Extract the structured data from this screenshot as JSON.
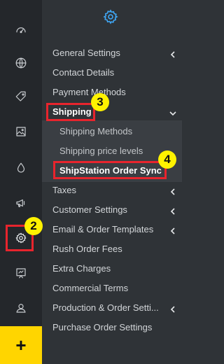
{
  "colors": {
    "rail": "#24272b",
    "panel": "#2f3337",
    "submenu": "#3a3e43",
    "accent": "#3fa7f5",
    "add_button": "#ffd500",
    "highlight": "#e8242d",
    "badge": "#fff200"
  },
  "rail": {
    "icons": [
      "dashboard-icon",
      "globe-icon",
      "tag-icon",
      "image-icon",
      "drop-icon",
      "megaphone-icon",
      "settings-icon",
      "presentation-icon",
      "user-icon"
    ],
    "add_label": "+"
  },
  "menu": {
    "general_settings": "General Settings",
    "contact_details": "Contact Details",
    "payment_methods": "Payment Methods",
    "shipping": "Shipping",
    "shipping_methods": "Shipping Methods",
    "shipping_price_levels": "Shipping price levels",
    "shipstation_sync": "ShipStation Order Sync",
    "taxes": "Taxes",
    "customer_settings": "Customer Settings",
    "email_templates": "Email & Order Templates",
    "rush_fees": "Rush Order Fees",
    "extra_charges": "Extra Charges",
    "commercial_terms": "Commercial Terms",
    "production_settings": "Production & Order Setti...",
    "purchase_order_settings": "Purchase Order Settings"
  },
  "annotations": {
    "badge_2": "2",
    "badge_3": "3",
    "badge_4": "4"
  }
}
